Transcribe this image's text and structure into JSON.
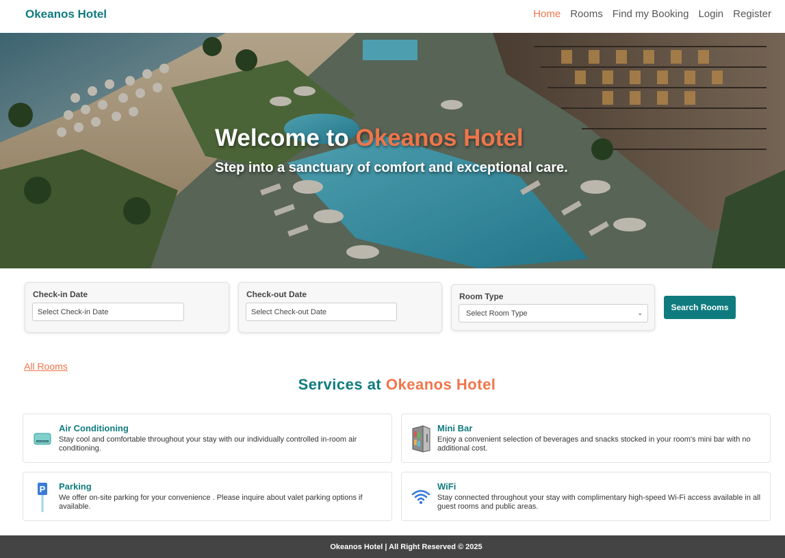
{
  "nav": {
    "brand": "Okeanos Hotel",
    "links": [
      {
        "label": "Home",
        "active": true
      },
      {
        "label": "Rooms"
      },
      {
        "label": "Find my Booking"
      },
      {
        "label": "Login"
      },
      {
        "label": "Register"
      }
    ]
  },
  "hero": {
    "title_prefix": "Welcome to ",
    "title_accent": "Okeanos Hotel",
    "subtitle": "Step into a sanctuary of comfort and exceptional care."
  },
  "search": {
    "checkin": {
      "label": "Check-in Date",
      "placeholder": "Select Check-in Date"
    },
    "checkout": {
      "label": "Check-out Date",
      "placeholder": "Select Check-out Date"
    },
    "room_type": {
      "label": "Room Type",
      "selected": "Select Room Type"
    },
    "button": "Search Rooms"
  },
  "all_rooms_link": "All Rooms",
  "services": {
    "heading_prefix": "Services at ",
    "heading_accent": "Okeanos Hotel",
    "items": [
      {
        "icon": "air-conditioner-icon",
        "title": "Air Conditioning",
        "description": "Stay cool and comfortable throughout your stay with our individually controlled in-room air conditioning."
      },
      {
        "icon": "mini-bar-icon",
        "title": "Mini Bar",
        "description": "Enjoy a convenient selection of beverages and snacks stocked in your room's mini bar with no additional cost."
      },
      {
        "icon": "parking-icon",
        "title": "Parking",
        "description": "We offer on-site parking for your convenience . Please inquire about valet parking options if available."
      },
      {
        "icon": "wifi-icon",
        "title": "WiFi",
        "description": "Stay connected throughout your stay with complimentary high-speed Wi-Fi access available in all guest rooms and public areas."
      }
    ]
  },
  "footer": "Okeanos Hotel | All Right Reserved © 2025",
  "colors": {
    "brand": "#0f7b7e",
    "accent": "#f0754a",
    "footer_bg": "#444444"
  }
}
